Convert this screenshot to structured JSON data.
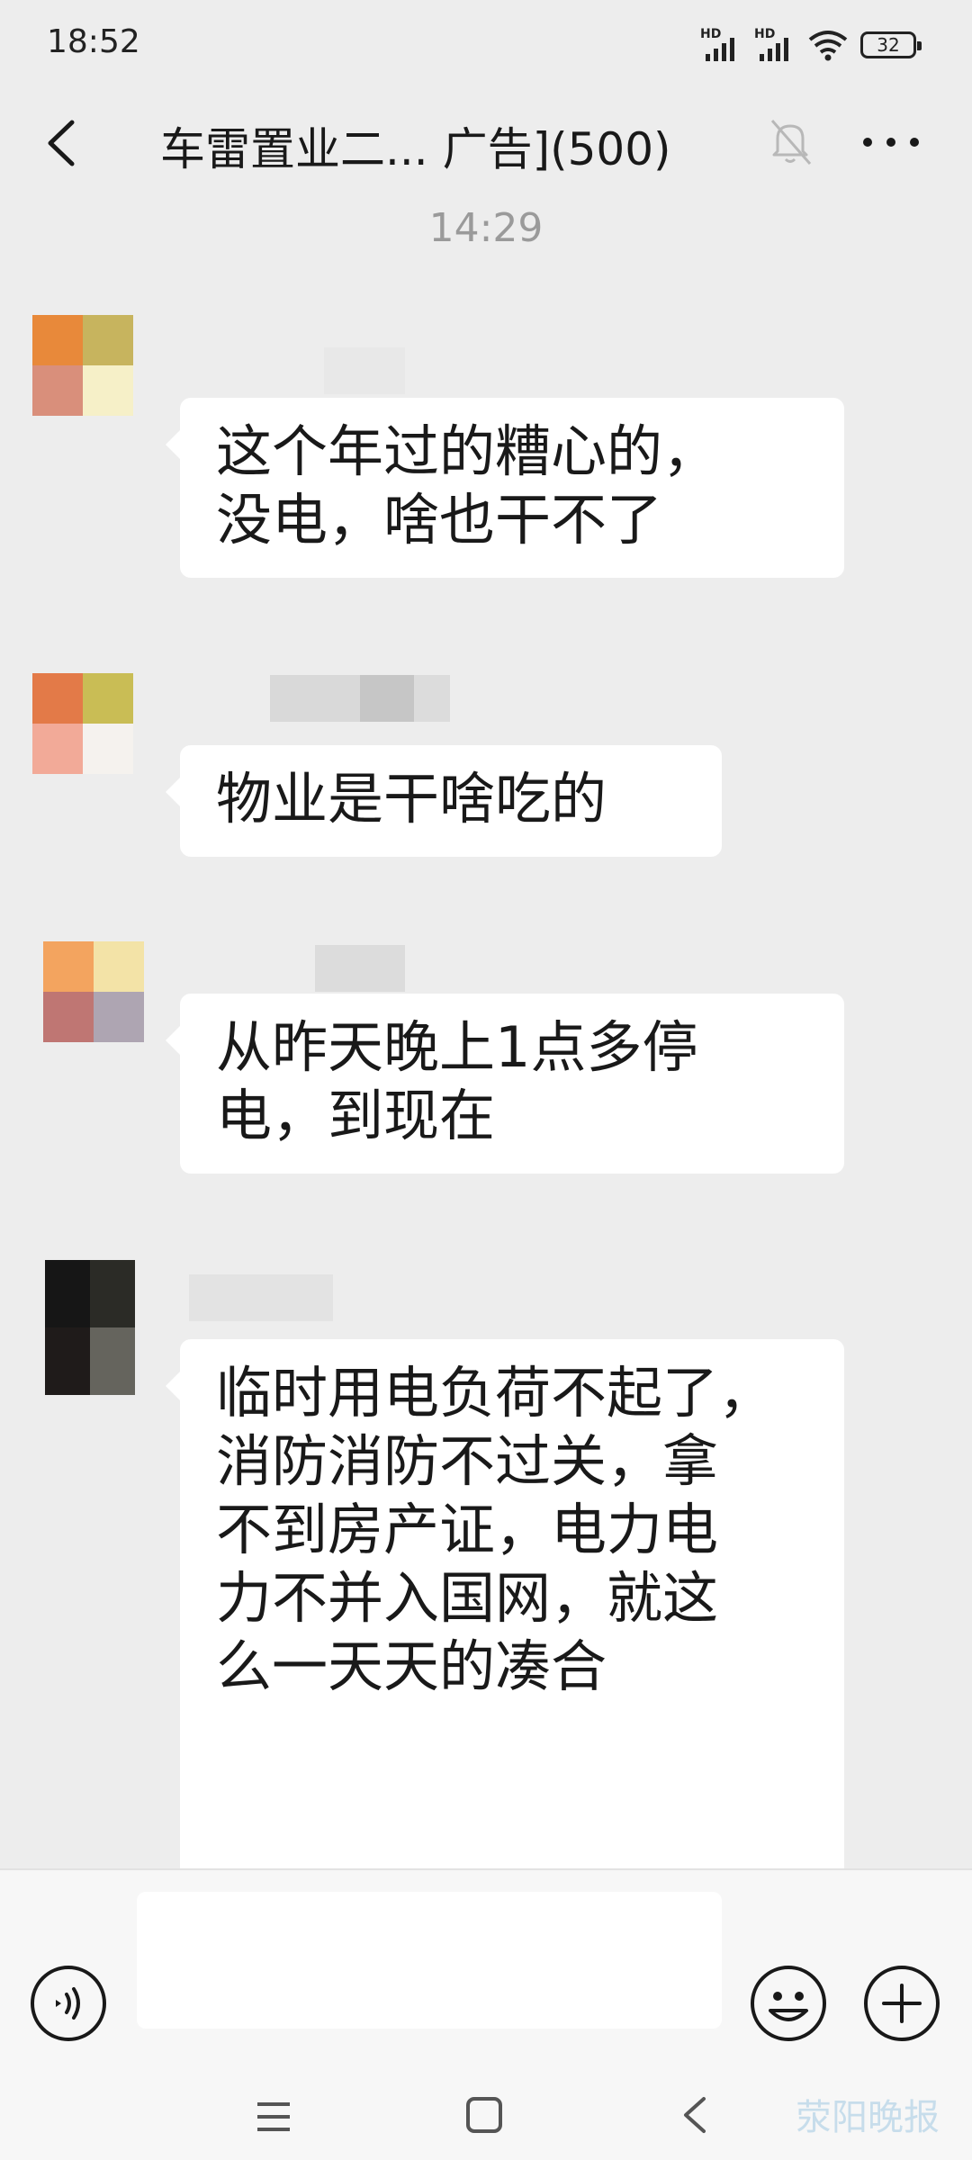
{
  "status_bar": {
    "time": "18:52",
    "signal_1_label": "HD",
    "signal_2_label": "HD",
    "battery": "32"
  },
  "header": {
    "title": "车雷置业二... 广告](500)",
    "back_icon": "chevron-left-icon",
    "mute_icon": "bell-off-icon",
    "more_icon": "more-dots-icon"
  },
  "timestamp": "14:29",
  "messages": [
    {
      "text": "这个年过的糟心的，\n没电，啥也干不了",
      "avatar_colors": [
        "#e8893a",
        "#c7b45e",
        "#d98f7b",
        "#f6f0c8"
      ]
    },
    {
      "text": "物业是干啥吃的",
      "avatar_colors": [
        "#e37a48",
        "#c9bd55",
        "#f2aa98",
        "#f5f2ee"
      ]
    },
    {
      "text": "从昨天晚上1点多停\n电，到现在",
      "avatar_colors": [
        "#f3a45f",
        "#f3e3a7",
        "#bf7673",
        "#aea5b2"
      ]
    },
    {
      "text": "临时用电负荷不起了，\n消防消防不过关，拿\n不到房产证，电力电\n力不并入国网，就这\n么一天天的凑合",
      "avatar_colors": [
        "#161616",
        "#2b2b26",
        "#1f1b1a",
        "#65645d"
      ]
    }
  ],
  "input_bar": {
    "voice_icon": "voice-icon",
    "emoji_icon": "emoji-icon",
    "plus_icon": "plus-icon",
    "input_value": ""
  },
  "nav_bar": {
    "menu_icon": "menu-icon",
    "home_icon": "home-square-icon",
    "back_icon": "back-triangle-icon"
  },
  "watermark": "荥阳晚报"
}
